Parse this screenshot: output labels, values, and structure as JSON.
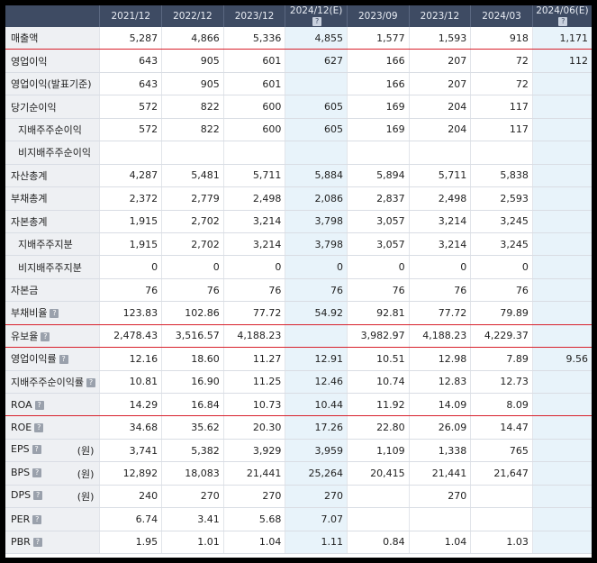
{
  "headers": [
    "2021/12",
    "2022/12",
    "2023/12",
    "2024/12(E)",
    "2023/09",
    "2023/12",
    "2024/03",
    "2024/06(E)"
  ],
  "rows": [
    {
      "label": "매출액",
      "values": [
        "5,287",
        "4,866",
        "5,336",
        "4,855",
        "1,577",
        "1,593",
        "918",
        "1,171"
      ],
      "sub": false,
      "icon": false,
      "unit": "",
      "red": true
    },
    {
      "label": "영업이익",
      "values": [
        "643",
        "905",
        "601",
        "627",
        "166",
        "207",
        "72",
        "112"
      ],
      "sub": false,
      "icon": false,
      "unit": "",
      "red": false
    },
    {
      "label": "영업이익(발표기준)",
      "values": [
        "643",
        "905",
        "601",
        "",
        "166",
        "207",
        "72",
        ""
      ],
      "sub": false,
      "icon": false,
      "unit": "",
      "red": false
    },
    {
      "label": "당기순이익",
      "values": [
        "572",
        "822",
        "600",
        "605",
        "169",
        "204",
        "117",
        ""
      ],
      "sub": false,
      "icon": false,
      "unit": "",
      "red": false
    },
    {
      "label": "지배주주순이익",
      "values": [
        "572",
        "822",
        "600",
        "605",
        "169",
        "204",
        "117",
        ""
      ],
      "sub": true,
      "icon": false,
      "unit": "",
      "red": false
    },
    {
      "label": "비지배주주순이익",
      "values": [
        "",
        "",
        "",
        "",
        "",
        "",
        "",
        ""
      ],
      "sub": true,
      "icon": false,
      "unit": "",
      "red": false
    },
    {
      "label": "자산총계",
      "values": [
        "4,287",
        "5,481",
        "5,711",
        "5,884",
        "5,894",
        "5,711",
        "5,838",
        ""
      ],
      "sub": false,
      "icon": false,
      "unit": "",
      "red": false
    },
    {
      "label": "부채총계",
      "values": [
        "2,372",
        "2,779",
        "2,498",
        "2,086",
        "2,837",
        "2,498",
        "2,593",
        ""
      ],
      "sub": false,
      "icon": false,
      "unit": "",
      "red": false
    },
    {
      "label": "자본총계",
      "values": [
        "1,915",
        "2,702",
        "3,214",
        "3,798",
        "3,057",
        "3,214",
        "3,245",
        ""
      ],
      "sub": false,
      "icon": false,
      "unit": "",
      "red": false
    },
    {
      "label": "지배주주지분",
      "values": [
        "1,915",
        "2,702",
        "3,214",
        "3,798",
        "3,057",
        "3,214",
        "3,245",
        ""
      ],
      "sub": true,
      "icon": false,
      "unit": "",
      "red": false
    },
    {
      "label": "비지배주주지분",
      "values": [
        "0",
        "0",
        "0",
        "0",
        "0",
        "0",
        "0",
        ""
      ],
      "sub": true,
      "icon": false,
      "unit": "",
      "red": false
    },
    {
      "label": "자본금",
      "values": [
        "76",
        "76",
        "76",
        "76",
        "76",
        "76",
        "76",
        ""
      ],
      "sub": false,
      "icon": false,
      "unit": "",
      "red": false
    },
    {
      "label": "부채비율",
      "values": [
        "123.83",
        "102.86",
        "77.72",
        "54.92",
        "92.81",
        "77.72",
        "79.89",
        ""
      ],
      "sub": false,
      "icon": true,
      "unit": "",
      "red": true
    },
    {
      "label": "유보율",
      "values": [
        "2,478.43",
        "3,516.57",
        "4,188.23",
        "",
        "3,982.97",
        "4,188.23",
        "4,229.37",
        ""
      ],
      "sub": false,
      "icon": true,
      "unit": "",
      "red": true
    },
    {
      "label": "영업이익률",
      "values": [
        "12.16",
        "18.60",
        "11.27",
        "12.91",
        "10.51",
        "12.98",
        "7.89",
        "9.56"
      ],
      "sub": false,
      "icon": true,
      "unit": "",
      "red": false
    },
    {
      "label": "지배주주순이익률",
      "values": [
        "10.81",
        "16.90",
        "11.25",
        "12.46",
        "10.74",
        "12.83",
        "12.73",
        ""
      ],
      "sub": false,
      "icon": true,
      "unit": "",
      "red": false
    },
    {
      "label": "ROA",
      "values": [
        "14.29",
        "16.84",
        "10.73",
        "10.44",
        "11.92",
        "14.09",
        "8.09",
        ""
      ],
      "sub": false,
      "icon": true,
      "unit": "",
      "red": true
    },
    {
      "label": "ROE",
      "values": [
        "34.68",
        "35.62",
        "20.30",
        "17.26",
        "22.80",
        "26.09",
        "14.47",
        ""
      ],
      "sub": false,
      "icon": true,
      "unit": "",
      "red": false
    },
    {
      "label": "EPS",
      "values": [
        "3,741",
        "5,382",
        "3,929",
        "3,959",
        "1,109",
        "1,338",
        "765",
        ""
      ],
      "sub": false,
      "icon": true,
      "unit": "(원)",
      "red": false
    },
    {
      "label": "BPS",
      "values": [
        "12,892",
        "18,083",
        "21,441",
        "25,264",
        "20,415",
        "21,441",
        "21,647",
        ""
      ],
      "sub": false,
      "icon": true,
      "unit": "(원)",
      "red": false
    },
    {
      "label": "DPS",
      "values": [
        "240",
        "270",
        "270",
        "270",
        "",
        "270",
        "",
        ""
      ],
      "sub": false,
      "icon": true,
      "unit": "(원)",
      "red": false
    },
    {
      "label": "PER",
      "values": [
        "6.74",
        "3.41",
        "5.68",
        "7.07",
        "",
        "",
        "",
        ""
      ],
      "sub": false,
      "icon": true,
      "unit": "",
      "red": false
    },
    {
      "label": "PBR",
      "values": [
        "1.95",
        "1.01",
        "1.04",
        "1.11",
        "0.84",
        "1.04",
        "1.03",
        ""
      ],
      "sub": false,
      "icon": true,
      "unit": "",
      "red": false
    }
  ],
  "estimate_columns": [
    3,
    7
  ],
  "help_icon_glyph": "?",
  "colors": {
    "header_bg": "#3e4b63",
    "label_bg": "#eef0f3",
    "estimate_bg": "#e8f3fa",
    "red_rule": "#d8202b"
  }
}
